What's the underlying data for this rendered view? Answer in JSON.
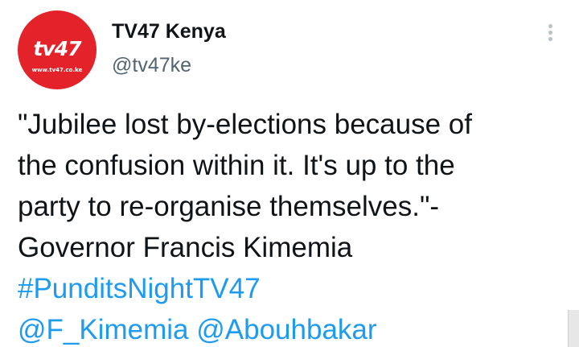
{
  "account": {
    "display_name": "TV47 Kenya",
    "handle": "@tv47ke",
    "avatar_logo": "tv47",
    "avatar_url": "www.tv47.co.ke",
    "avatar_color": "#e3222a"
  },
  "menu": {
    "icon": "more-vertical-icon"
  },
  "tweet": {
    "lines": [
      "\"Jubilee lost by-elections because of",
      "the confusion within it. It's up to the",
      "party to re-organise themselves.\"-",
      "Governor Francis Kimemia"
    ],
    "hashtag": "#PunditsNightTV47",
    "mentions": [
      "@F_Kimemia",
      "@Abouhbakar"
    ]
  },
  "colors": {
    "text": "#0f1419",
    "secondary_text": "#536471",
    "link": "#1d9bf0"
  }
}
